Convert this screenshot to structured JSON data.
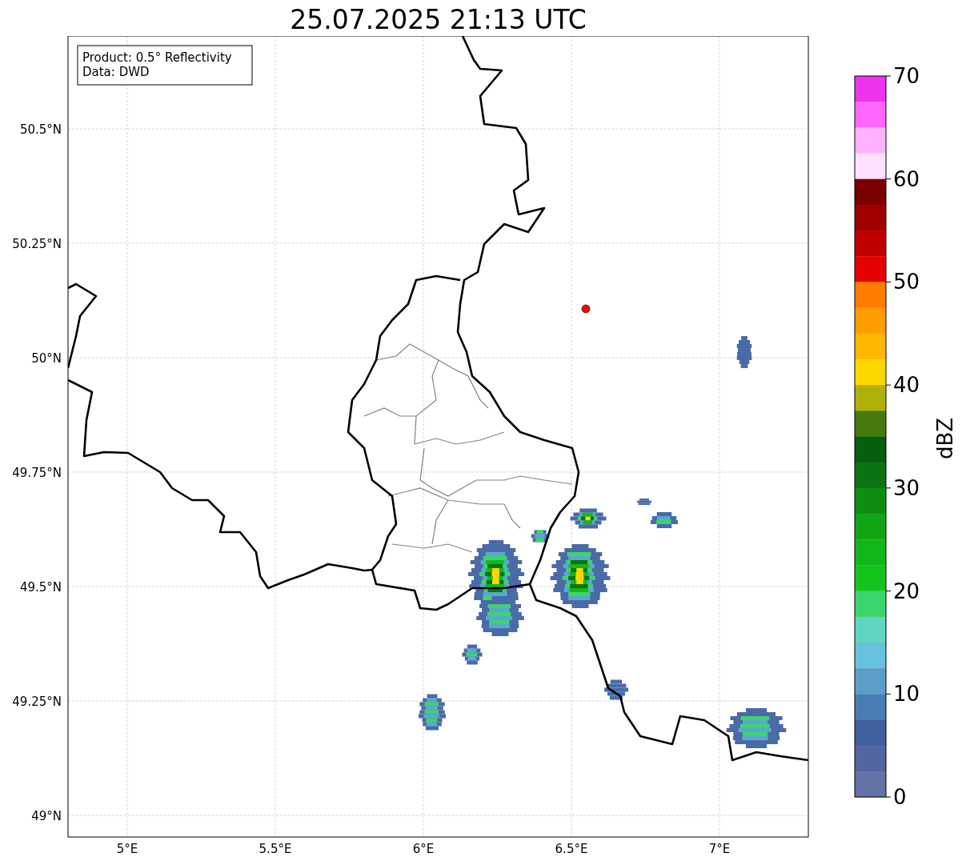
{
  "title": "25.07.2025 21:13 UTC",
  "map": {
    "info_lines": [
      "Product: 0.5° Reflectivity",
      "Data: DWD"
    ],
    "lat_ticks": [
      "50.5°N",
      "50.25°N",
      "50°N",
      "49.75°N",
      "49.5°N",
      "49.25°N",
      "49°N"
    ],
    "lon_ticks": [
      "5°E",
      "5.5°E",
      "6°E",
      "6.5°E",
      "7°E"
    ]
  },
  "colorbar": {
    "label": "dBZ",
    "ticks": [
      "70",
      "60",
      "50",
      "40",
      "30",
      "20",
      "10",
      "0"
    ],
    "segments": [
      {
        "color": "#ee33ee"
      },
      {
        "color": "#ff66ff"
      },
      {
        "color": "#ffb3ff"
      },
      {
        "color": "#ffe0ff"
      },
      {
        "color": "#7a0000"
      },
      {
        "color": "#a00000"
      },
      {
        "color": "#c00000"
      },
      {
        "color": "#e60000"
      },
      {
        "color": "#ff7c00"
      },
      {
        "color": "#ff9c00"
      },
      {
        "color": "#ffb700"
      },
      {
        "color": "#ffd700"
      },
      {
        "color": "#afb107"
      },
      {
        "color": "#457a0c"
      },
      {
        "color": "#075e0c"
      },
      {
        "color": "#0a7510"
      },
      {
        "color": "#0f8c12"
      },
      {
        "color": "#11a515"
      },
      {
        "color": "#12b81a"
      },
      {
        "color": "#12c41c"
      },
      {
        "color": "#3dd46d"
      },
      {
        "color": "#5fd6c0"
      },
      {
        "color": "#66c2dd"
      },
      {
        "color": "#5b9ec8"
      },
      {
        "color": "#4a7db5"
      },
      {
        "color": "#4160a0"
      },
      {
        "color": "#5366a0"
      },
      {
        "color": "#6473a5"
      }
    ]
  }
}
